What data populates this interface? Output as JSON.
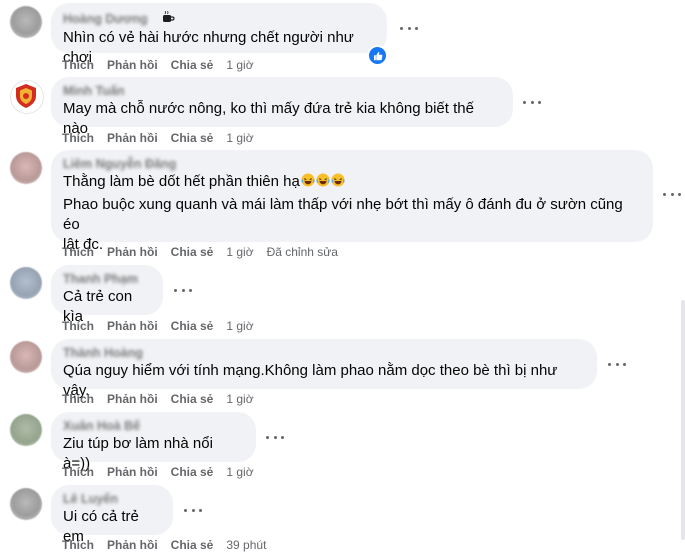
{
  "labels": {
    "like": "Thích",
    "reply": "Phản hồi",
    "share": "Chia sẻ"
  },
  "comments": [
    {
      "author": "Hoàng Dương",
      "text": "Nhìn có vẻ hài hước nhưng chết người như chơi",
      "time": "1 giờ",
      "edited": ""
    },
    {
      "author": "Minh Tuấn",
      "text": "May mà chỗ nước nông, ko thì mấy đứa trẻ kia không biết thế nào",
      "time": "1 giờ",
      "edited": ""
    },
    {
      "author": "Liêm Nguyễn Đăng",
      "text1": "Thằng làm bè dốt hết phần thiên hạ",
      "text2": "Phao buộc xung quanh và mái làm thấp với nhẹ bớt thì mấy ô đánh đu ở sườn cũng éo",
      "text3": "lật đc.",
      "time": "1 giờ",
      "edited": "Đã chỉnh sửa"
    },
    {
      "author": "Thanh Phạm",
      "text": "Cả trẻ con kìa",
      "time": "1 giờ",
      "edited": ""
    },
    {
      "author": "Thành Hoàng",
      "text": "Qúa nguy hiểm với tính mạng.Không làm phao nằm dọc theo bè thì bị như vậy.",
      "time": "1 giờ",
      "edited": ""
    },
    {
      "author": "Xuân Hoà Bế",
      "text": "Ziu túp bơ làm nhà nổi à=))",
      "time": "1 giờ",
      "edited": ""
    },
    {
      "author": "Lê Luyến",
      "text": "Ui có cả trẻ em",
      "time": "39 phút",
      "edited": ""
    }
  ],
  "colors": {
    "bubble": "#f0f2f5",
    "meta": "#65676b",
    "like_blue": "#1877f2"
  }
}
